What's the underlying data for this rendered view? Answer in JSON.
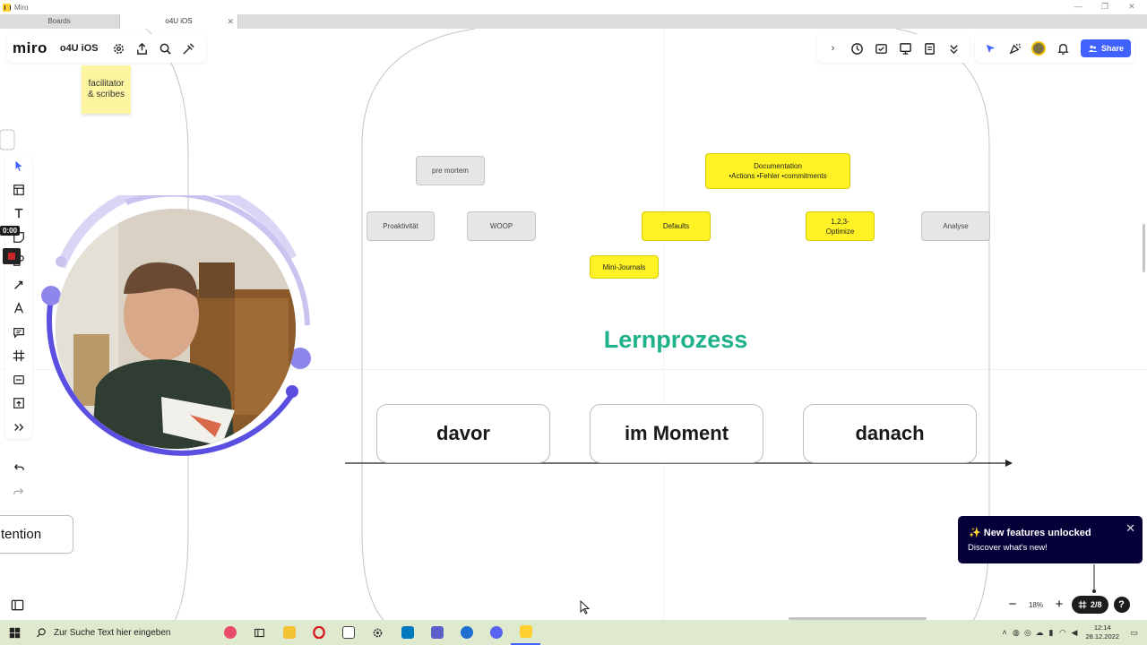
{
  "window": {
    "title": "Miro"
  },
  "tabs": [
    {
      "label": "Boards"
    },
    {
      "label": "o4U iOS"
    }
  ],
  "toolbar": {
    "logo": "miro",
    "board_name": "o4U iOS",
    "share_label": "Share"
  },
  "stickies": {
    "facilitator": "facilitator\n& scribes"
  },
  "recording": {
    "timer": "0:00"
  },
  "cards": {
    "pre_mortem": "pre mortem",
    "documentation_title": "Documentation",
    "documentation_items": "•Actions •Fehler •commitments",
    "proaktivitaet": "Proaktivität",
    "woop": "WOOP",
    "defaults": "Defaults",
    "optimize": "1,2,3-\nOptimize",
    "analyse": "Analyse",
    "mini_journals": "Mini-Journals"
  },
  "main": {
    "title": "Lernprozess",
    "phases": [
      "davor",
      "im Moment",
      "danach"
    ],
    "cut_label": "tention"
  },
  "notification": {
    "title": "New features unlocked",
    "subtitle": "Discover what's new!",
    "sparkle": "✨"
  },
  "zoom": {
    "value": "18%",
    "frames": "2/8",
    "help": "?"
  },
  "taskbar": {
    "search_placeholder": "Zur Suche Text hier eingeben",
    "time": "12:14",
    "date": "28.12.2022"
  },
  "colors": {
    "accent": "#4262ff",
    "title_green": "#1fb28a",
    "sticky_yellow": "#fdf59f",
    "card_yellow": "#fff325",
    "notification_bg": "#050038"
  }
}
